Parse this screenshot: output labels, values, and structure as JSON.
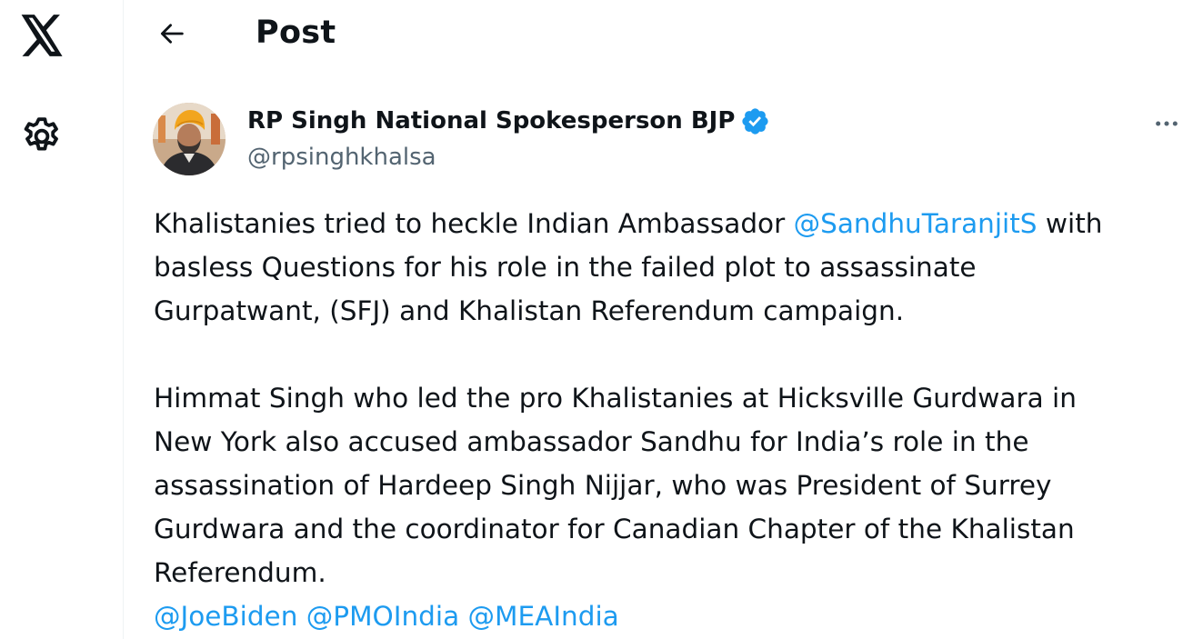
{
  "rail": {
    "logo_icon": "x-logo-icon",
    "settings_icon": "gear-icon"
  },
  "header": {
    "back_icon": "arrow-left-icon",
    "title": "Post"
  },
  "post": {
    "author": {
      "name": "RP Singh National Spokesperson BJP",
      "handle": "@rpsinghkhalsa",
      "verified": true,
      "verified_color": "#1d9bf0"
    },
    "more_icon": "more-horizontal-icon",
    "text": {
      "p1": {
        "l1a": "Khalistanies tried to heckle Indian Ambassador ",
        "l1_mention": "@SandhuTaranjitS",
        "l1b": " with",
        "l2": "basless Questions for his role in the failed plot to assassinate",
        "l3": "Gurpatwant, (SFJ) and Khalistan Referendum campaign."
      },
      "p2": {
        "l1": "Himmat Singh who led the pro Khalistanies at Hicksville Gurdwara in",
        "l2": "New York also accused ambassador Sandhu for India’s role in the",
        "l3": "assassination of Hardeep Singh Nijjar, who was President of Surrey",
        "l4": "Gurdwara and the coordinator for Canadian Chapter of the Khalistan",
        "l5": "Referendum."
      },
      "mentions": [
        "@JoeBiden",
        "@PMOIndia",
        "@MEAIndia"
      ]
    }
  },
  "colors": {
    "link": "#1d9bf0",
    "text": "#0f1419",
    "secondary": "#536471",
    "border": "#eff3f4"
  }
}
